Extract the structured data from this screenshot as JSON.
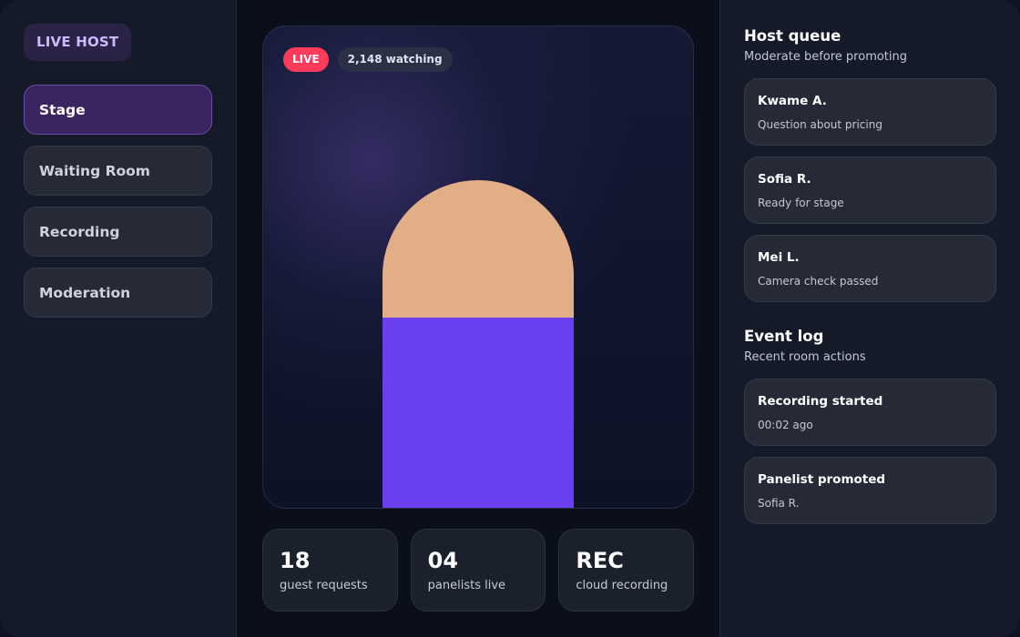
{
  "sidebar": {
    "brand": "LIVE HOST",
    "items": [
      {
        "label": "Stage",
        "active": true
      },
      {
        "label": "Waiting Room",
        "active": false
      },
      {
        "label": "Recording",
        "active": false
      },
      {
        "label": "Moderation",
        "active": false
      }
    ]
  },
  "stage": {
    "live_label": "LIVE",
    "watching_label": "2,148 watching"
  },
  "metrics": [
    {
      "value": "18",
      "label": "guest requests"
    },
    {
      "value": "04",
      "label": "panelists live"
    },
    {
      "value": "REC",
      "label": "cloud recording"
    }
  ],
  "right": {
    "queue": {
      "title": "Host queue",
      "subtitle": "Moderate before promoting",
      "items": [
        {
          "name": "Kwame A.",
          "status": "Question about pricing"
        },
        {
          "name": "Sofia R.",
          "status": "Ready for stage"
        },
        {
          "name": "Mei L.",
          "status": "Camera check passed"
        }
      ]
    },
    "log": {
      "title": "Event log",
      "subtitle": "Recent room actions",
      "items": [
        {
          "title": "Recording started",
          "detail": "00:02 ago"
        },
        {
          "title": "Panelist promoted",
          "detail": "Sofia R."
        }
      ]
    }
  },
  "colors": {
    "accent": "#6a3ff0",
    "live": "#ff3b5c",
    "avatar_skin": "#e1ae88",
    "brand_text": "#cdb9ff"
  }
}
